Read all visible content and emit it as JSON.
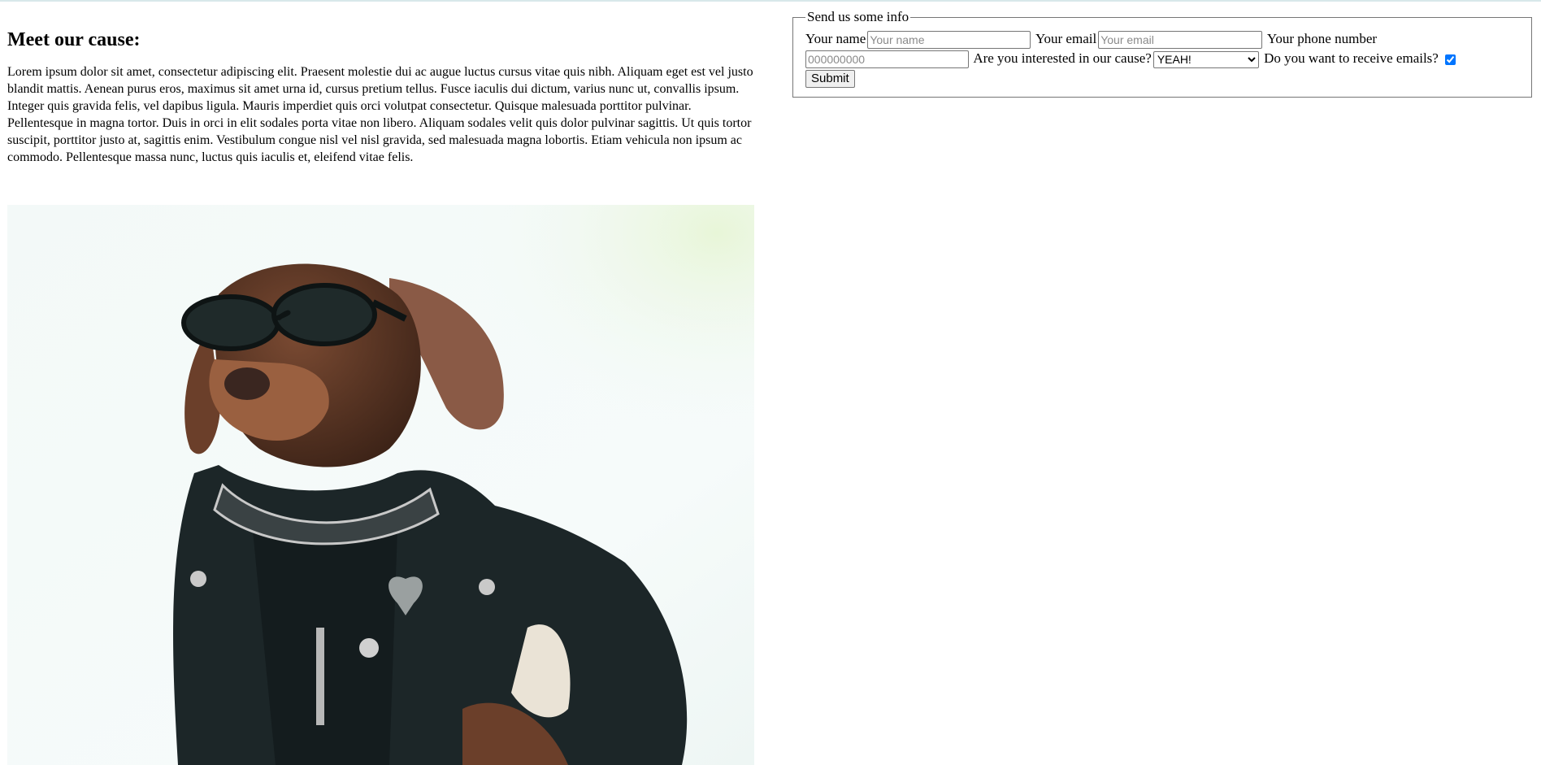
{
  "main": {
    "title": "Meet our cause:",
    "paragraph": "Lorem ipsum dolor sit amet, consectetur adipiscing elit. Praesent molestie dui ac augue luctus cursus vitae quis nibh. Aliquam eget est vel justo blandit mattis. Aenean purus eros, maximus sit amet urna id, cursus pretium tellus. Fusce iaculis dui dictum, varius nunc ut, convallis ipsum. Integer quis gravida felis, vel dapibus ligula. Mauris imperdiet quis orci volutpat consectetur. Quisque malesuada porttitor pulvinar. Pellentesque in magna tortor. Duis in orci in elit sodales porta vitae non libero. Aliquam sodales velit quis dolor pulvinar sagittis. Ut quis tortor suscipit, porttitor justo at, sagittis enim. Vestibulum congue nisl vel nisl gravida, sed malesuada magna lobortis. Etiam vehicula non ipsum ac commodo. Pellentesque massa nunc, luctus quis iaculis et, eleifend vitae felis."
  },
  "form": {
    "legend": "Send us some info",
    "name_label": "Your name",
    "name_placeholder": "Your name",
    "name_value": "",
    "email_label": "Your email",
    "email_placeholder": "Your email",
    "email_value": "",
    "phone_label": "Your phone number",
    "phone_placeholder": "000000000",
    "phone_value": "",
    "interest_label": "Are you interested in our cause?",
    "interest_selected": "YEAH!",
    "emails_label": "Do you want to receive emails?",
    "emails_checked": true,
    "submit_label": "Submit"
  },
  "colors": {
    "checkbox_accent": "#0075ff"
  }
}
